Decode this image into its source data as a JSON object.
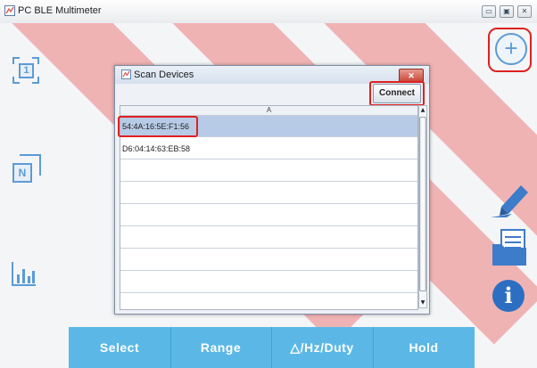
{
  "window": {
    "title": "PC BLE Multimeter",
    "controls": {
      "minimize": "▭",
      "maximize": "▣",
      "close": "✕"
    }
  },
  "left_icons": {
    "single_label": "1",
    "multi_label": "N"
  },
  "dialog": {
    "title": "Scan Devices",
    "close_label": "✕",
    "connect_label": "Connect",
    "column_header": "A",
    "devices": [
      {
        "address": "54:4A:16:5E:F1:56",
        "selected": true
      },
      {
        "address": "D6:04:14:63:EB:58",
        "selected": false
      },
      {
        "address": ""
      },
      {
        "address": ""
      },
      {
        "address": ""
      },
      {
        "address": ""
      },
      {
        "address": ""
      },
      {
        "address": ""
      },
      {
        "address": ""
      }
    ]
  },
  "right_icons": {
    "add_label": "+",
    "info_label": "i",
    "icons": [
      "add-device-icon",
      "pen-icon",
      "folder-icon",
      "info-icon"
    ]
  },
  "toolbar": {
    "select_label": "Select",
    "range_label": "Range",
    "hz_duty_label": "△/Hz/Duty",
    "hold_label": "Hold"
  },
  "colors": {
    "accent": "#5b9bd5",
    "toolbar": "#5bb8e6",
    "highlight": "#e02020",
    "selected_row": "#b7cbe6"
  }
}
